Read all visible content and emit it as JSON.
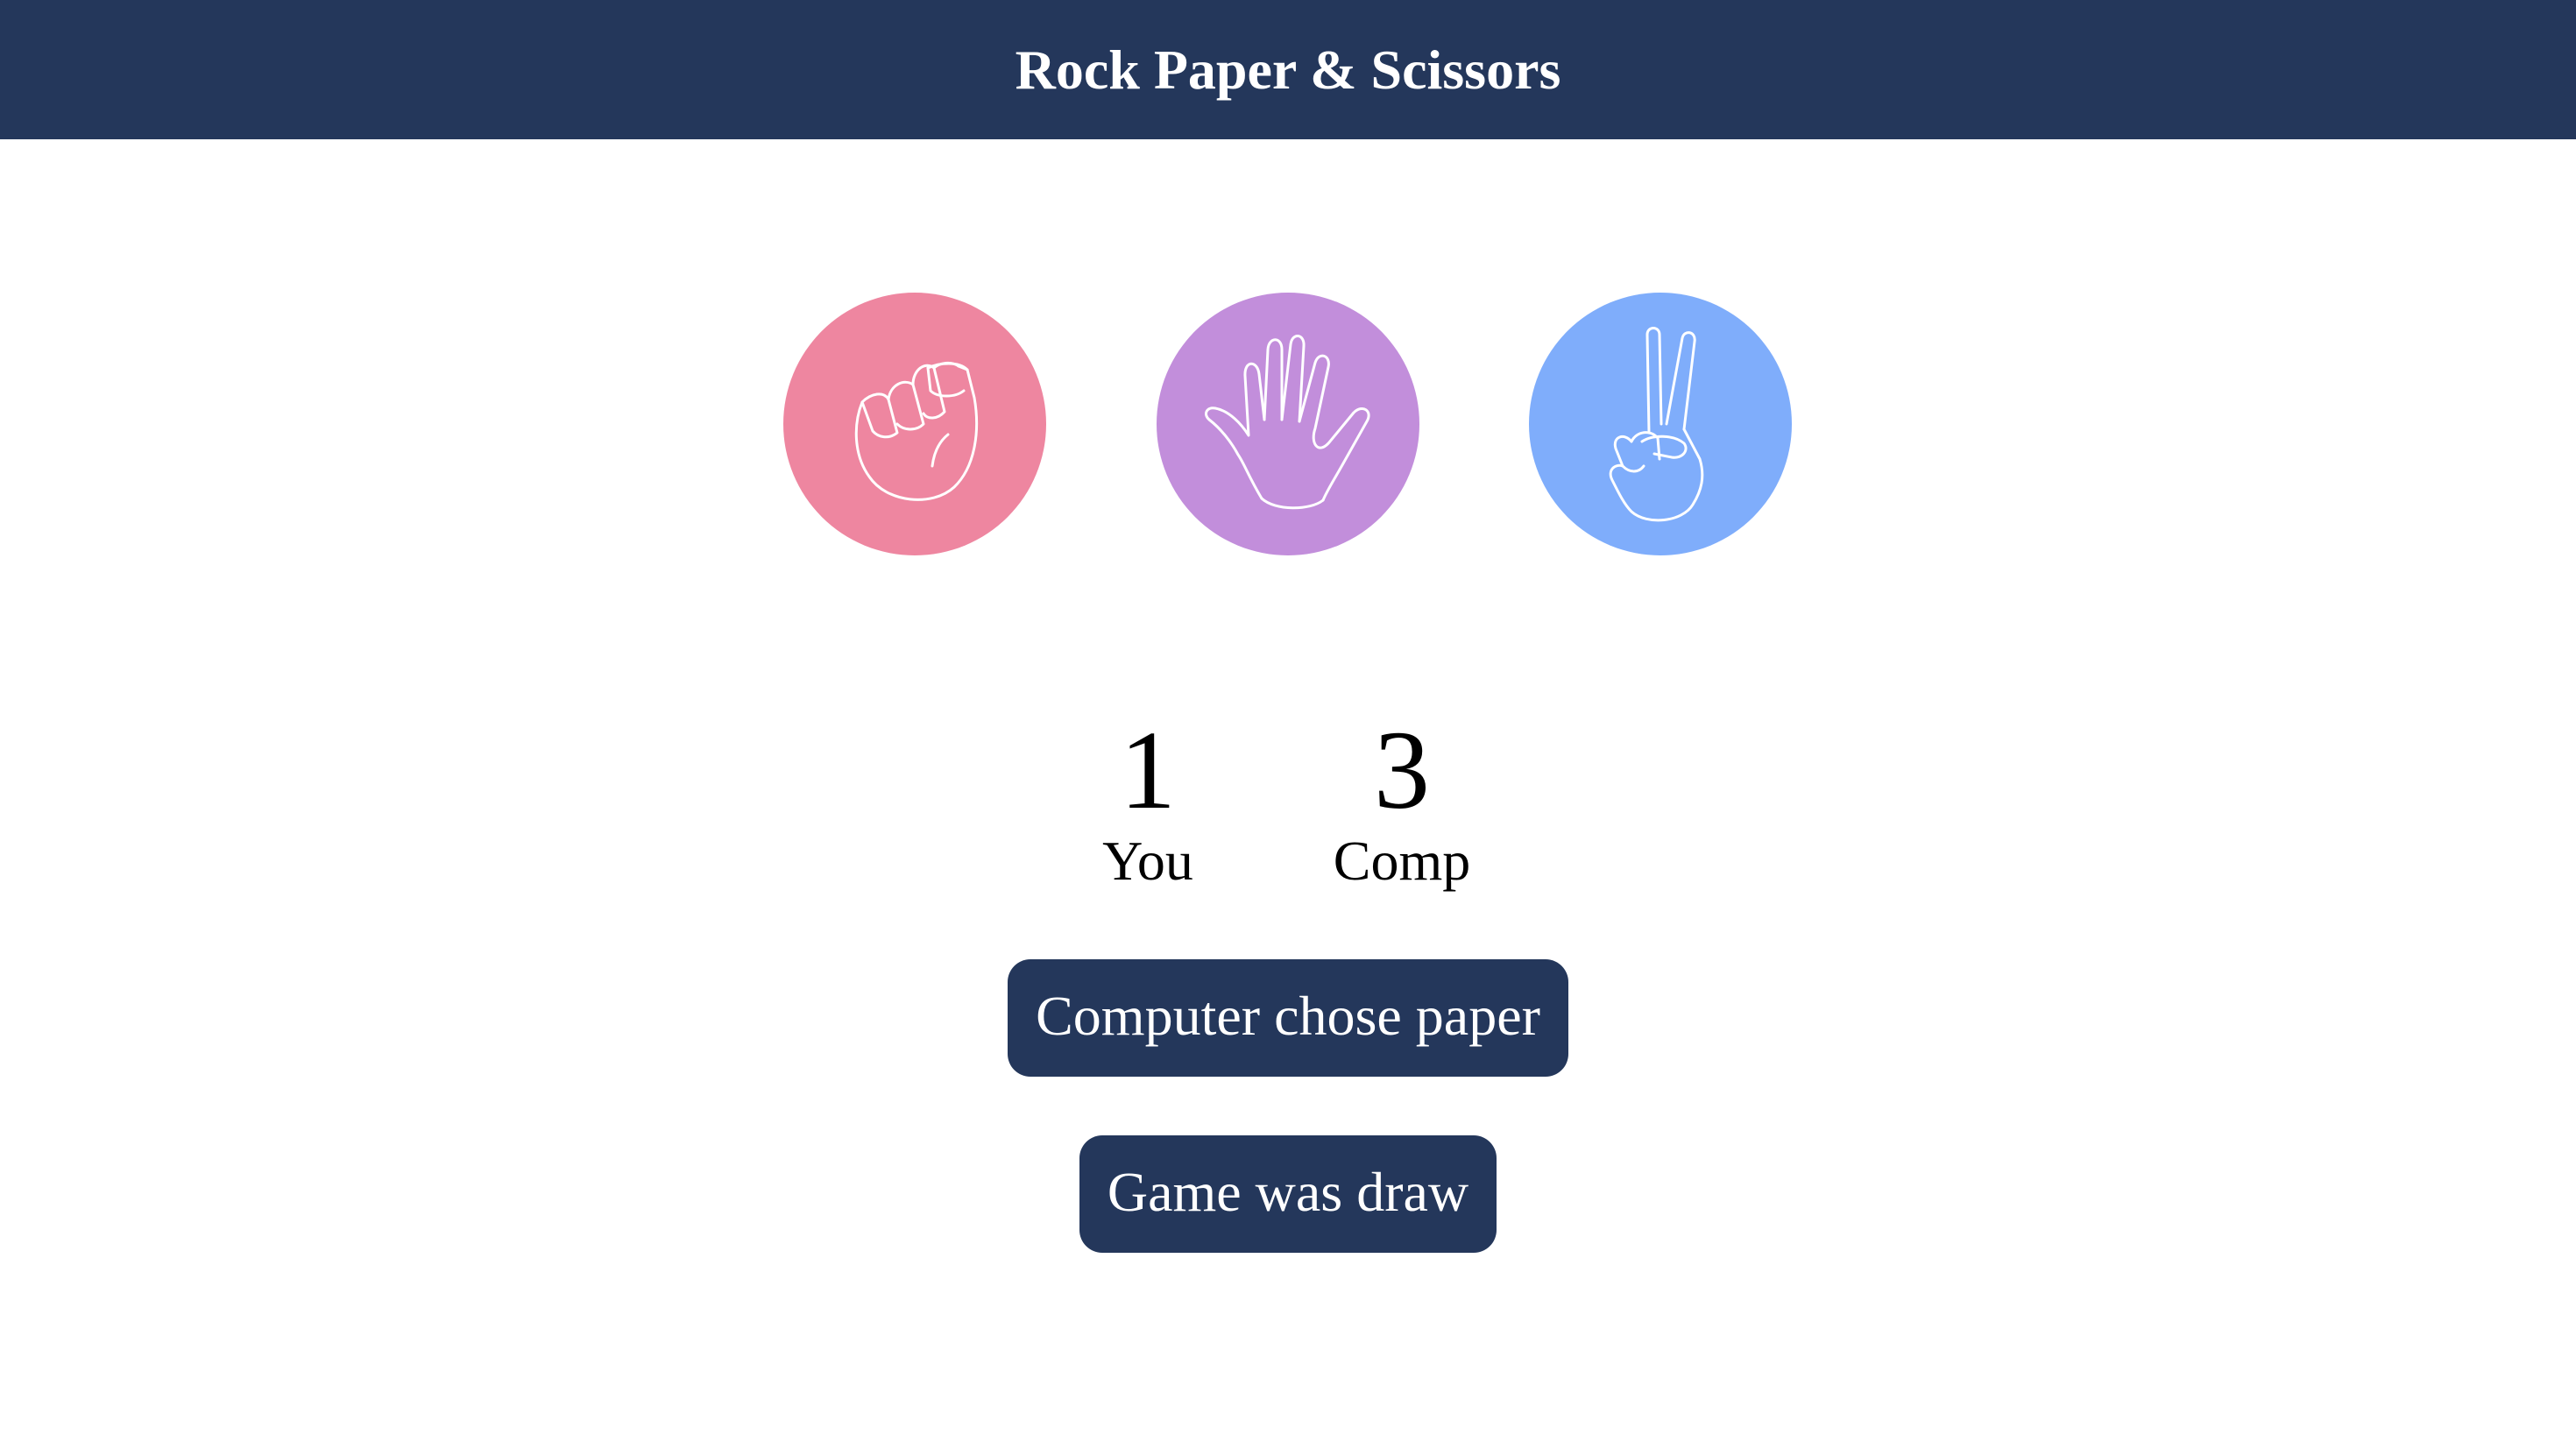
{
  "header": {
    "title": "Rock Paper & Scissors"
  },
  "choices": [
    {
      "id": "rock",
      "icon": "rock-fist-icon",
      "color": "#ee86a0"
    },
    {
      "id": "paper",
      "icon": "paper-hand-icon",
      "color": "#c28edb"
    },
    {
      "id": "scissors",
      "icon": "scissors-hand-icon",
      "color": "#7fadfb"
    }
  ],
  "scoreboard": {
    "user_score": "1",
    "user_label": "You",
    "comp_score": "3",
    "comp_label": "Comp"
  },
  "messages": {
    "computer_choice": "Computer chose paper",
    "result": "Game was draw"
  },
  "colors": {
    "header_bg": "#24375b",
    "message_bg": "#24375b"
  }
}
